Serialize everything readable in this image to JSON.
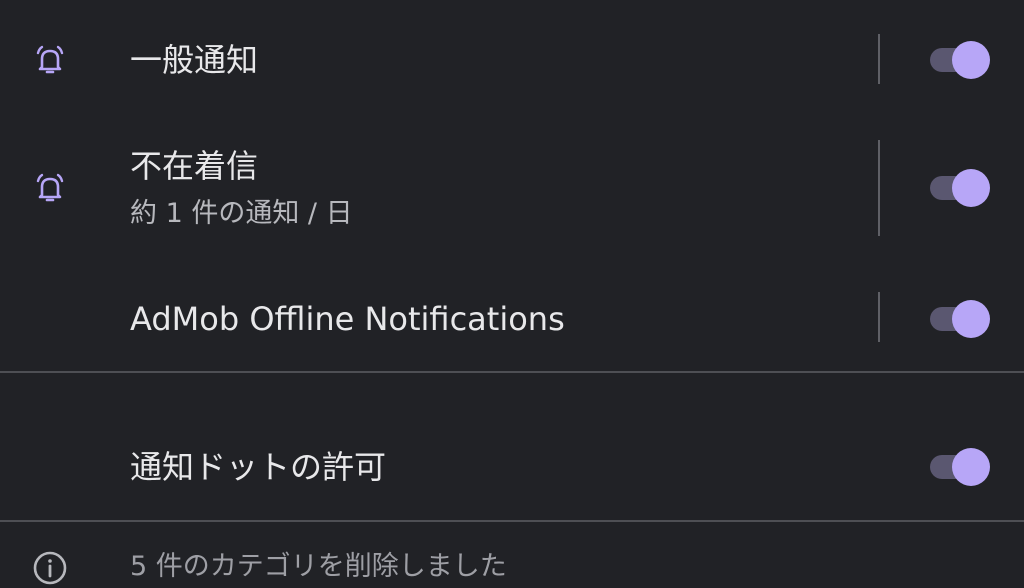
{
  "channels": [
    {
      "title": "一般通知",
      "subtitle": "",
      "icon": "bell-ring-icon",
      "enabled": true
    },
    {
      "title": "不在着信",
      "subtitle": "約 1 件の通知 / 日",
      "icon": "bell-ring-icon",
      "enabled": true
    },
    {
      "title": "AdMob Offline Notifications",
      "subtitle": "",
      "icon": "",
      "enabled": true
    }
  ],
  "dots": {
    "title": "通知ドットの許可",
    "enabled": true
  },
  "footer": {
    "text": "5 件のカテゴリを削除しました",
    "icon": "info-icon"
  },
  "colors": {
    "background": "#212226",
    "accent": "#b7a6f7",
    "track": "#5a5770",
    "divider": "#4e4f54"
  }
}
